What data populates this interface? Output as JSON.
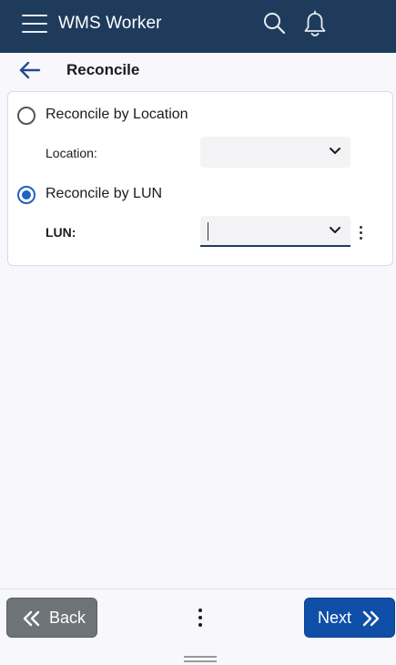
{
  "header": {
    "app_title": "WMS Worker",
    "menu_icon": "hamburger-menu-icon",
    "search_icon": "search-icon",
    "notifications_icon": "bell-icon",
    "background_color": "#1f3b5c"
  },
  "subheader": {
    "title": "Reconcile",
    "back_icon": "arrow-left-icon"
  },
  "form": {
    "option_location": {
      "label": "Reconcile by Location",
      "selected": false
    },
    "location_field": {
      "label": "Location:",
      "value": ""
    },
    "option_lun": {
      "label": "Reconcile by LUN",
      "selected": true
    },
    "lun_field": {
      "label": "LUN:",
      "value": ""
    },
    "accent_color": "#2161c4"
  },
  "footer": {
    "back_label": "Back",
    "next_label": "Next",
    "back_color": "#6e7378",
    "next_color": "#0f4fa8"
  }
}
